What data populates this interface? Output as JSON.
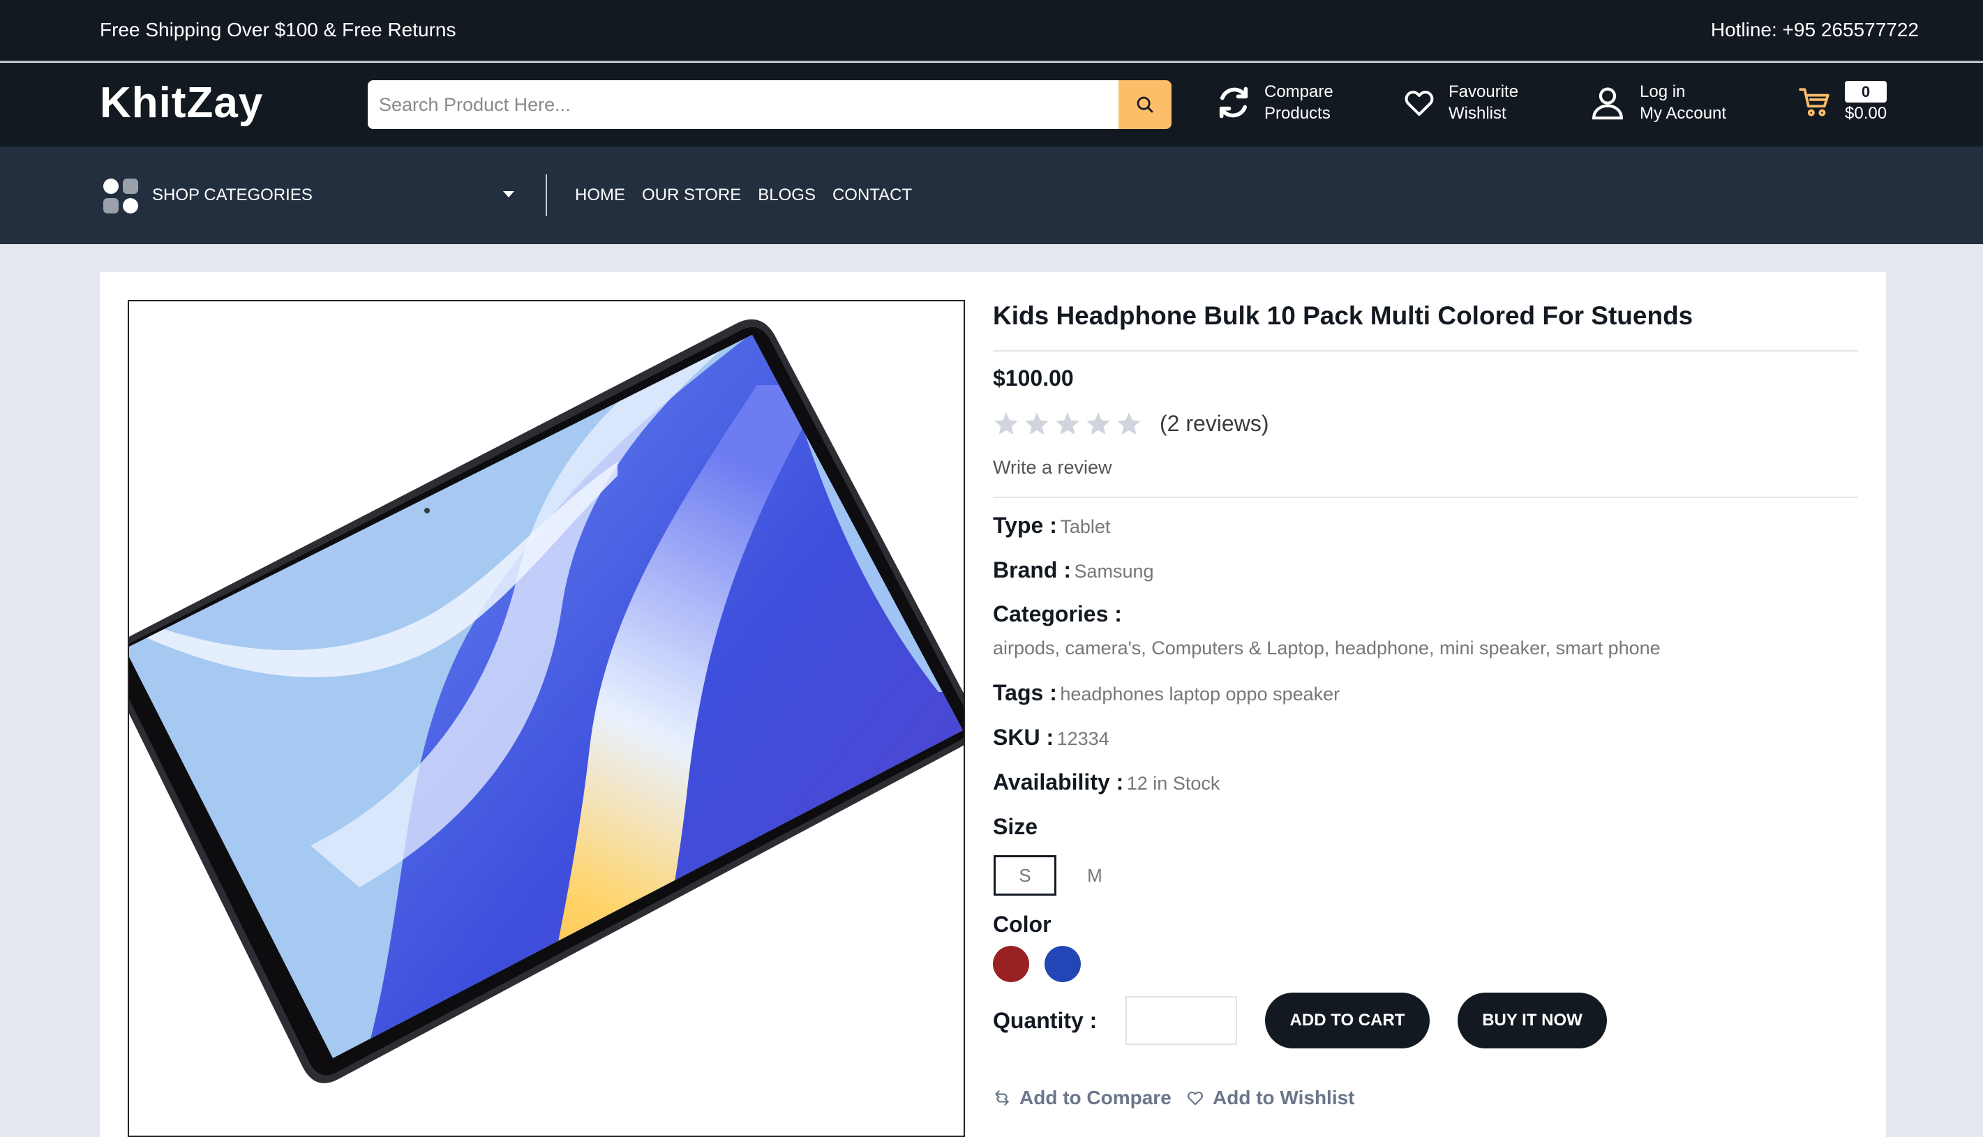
{
  "topbar": {
    "promo": "Free Shipping Over $100 & Free Returns",
    "hotline": "Hotline: +95 265577722"
  },
  "header": {
    "logo": "KhitZay",
    "search_placeholder": "Search Product Here...",
    "compare_line1": "Compare",
    "compare_line2": "Products",
    "wishlist_line1": "Favourite",
    "wishlist_line2": "Wishlist",
    "account_line1": "Log in",
    "account_line2": "My Account",
    "cart_count": "0",
    "cart_total": "$0.00"
  },
  "nav": {
    "categories_label": "SHOP CATEGORIES",
    "menu": [
      "HOME",
      "OUR STORE",
      "BLOGS",
      "CONTACT"
    ]
  },
  "product": {
    "title": "Kids Headphone Bulk 10 Pack Multi Colored For Stuends",
    "price": "$100.00",
    "rating": 0,
    "rating_max": 5,
    "reviews": "(2 reviews)",
    "write_review": "Write a review",
    "type_label": "Type :",
    "type_value": "Tablet",
    "brand_label": "Brand :",
    "brand_value": "Samsung",
    "categories_label": "Categories :",
    "categories_value": "airpods, camera's, Computers & Laptop, headphone, mini speaker, smart phone",
    "tags_label": "Tags :",
    "tags_value": "headphones laptop oppo speaker",
    "sku_label": "SKU :",
    "sku_value": "12334",
    "availability_label": "Availability :",
    "availability_value": "12 in Stock",
    "size_label": "Size",
    "sizes": [
      "S",
      "M"
    ],
    "selected_size": "S",
    "color_label": "Color",
    "colors": [
      "#982222",
      "#2345b5"
    ],
    "quantity_label": "Quantity :",
    "quantity_value": "",
    "add_to_cart": "ADD TO CART",
    "buy_now": "BUY IT NOW",
    "add_to_compare": "Add to Compare",
    "add_to_wishlist": "Add to Wishlist"
  },
  "colors": {
    "dark": "#131921",
    "nav": "#232f3e",
    "accent": "#febd69",
    "page_bg": "#e4e8f0"
  },
  "icons": {
    "search": "search-icon",
    "compare": "refresh-icon",
    "wishlist": "heart-icon",
    "account": "user-icon",
    "cart": "cart-icon",
    "categories": "grid-icon"
  }
}
